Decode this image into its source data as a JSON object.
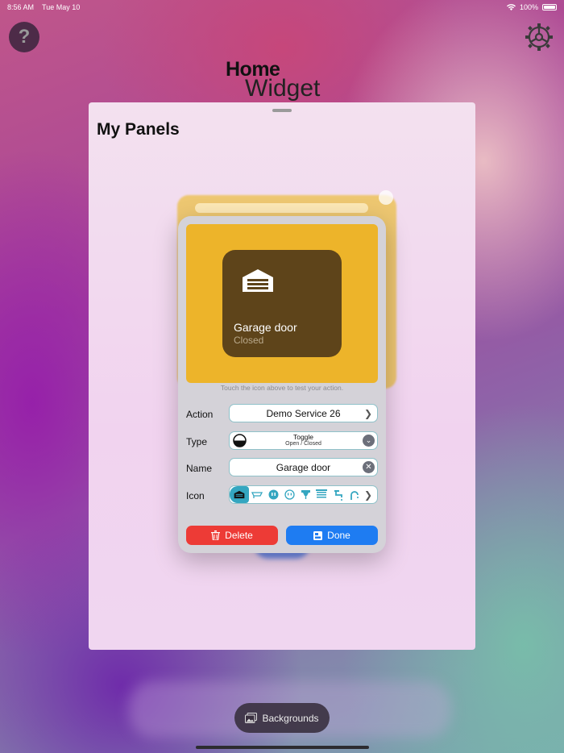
{
  "status_bar": {
    "time": "8:56 AM",
    "date": "Tue May 10",
    "battery": "100%"
  },
  "header": {
    "title_line1": "Home",
    "title_line2": "Widget",
    "help_glyph": "?"
  },
  "sheet": {
    "title": "My Panels"
  },
  "editor": {
    "preview": {
      "name": "Garage door",
      "status": "Closed",
      "icon": "garage-door-icon"
    },
    "hint": "Touch the icon above to test your action.",
    "action": {
      "label": "Action",
      "value": "Demo Service 26"
    },
    "type": {
      "label": "Type",
      "value": "Toggle",
      "subvalue": "Open / Closed"
    },
    "name": {
      "label": "Name",
      "value": "Garage door"
    },
    "icon": {
      "label": "Icon"
    },
    "delete_label": "Delete",
    "done_label": "Done"
  },
  "footer": {
    "backgrounds_label": "Backgrounds"
  },
  "colors": {
    "accent": "#1e7cf2",
    "danger": "#ed3b36",
    "tile_bg": "#5e441a",
    "preview_bg": "#edb42a",
    "icon_tint": "#34a6c0"
  }
}
